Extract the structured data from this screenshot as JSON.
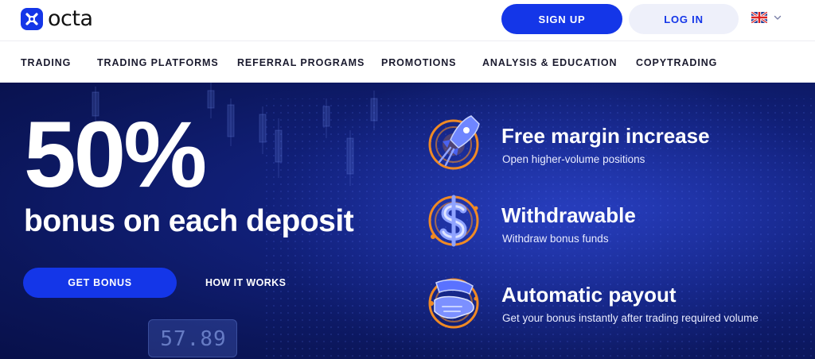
{
  "brand": {
    "name": "octa"
  },
  "header": {
    "signup_label": "SIGN UP",
    "login_label": "LOG IN",
    "language_icon": "uk-flag-icon",
    "language_chevron": "chevron-down-icon"
  },
  "nav": {
    "items": [
      {
        "label": "TRADING"
      },
      {
        "label": "TRADING PLATFORMS"
      },
      {
        "label": "REFERRAL PROGRAMS"
      },
      {
        "label": "PROMOTIONS"
      },
      {
        "label": "ANALYSIS & EDUCATION"
      },
      {
        "label": "COPYTRADING"
      }
    ]
  },
  "hero": {
    "headline": "50%",
    "subheadline": "bonus on each deposit",
    "cta_label": "GET BONUS",
    "secondary_link": "HOW IT WORKS",
    "ticker_value": "57.89",
    "features": [
      {
        "icon": "rocket-icon",
        "title": "Free margin increase",
        "description": "Open higher-volume positions"
      },
      {
        "icon": "dollar-icon",
        "title": "Withdrawable",
        "description": "Withdraw bonus funds"
      },
      {
        "icon": "money-hand-icon",
        "title": "Automatic payout",
        "description": "Get your bonus instantly after trading required volume"
      }
    ]
  },
  "colors": {
    "brand_blue": "#1436e8",
    "hero_background": "#0b165a",
    "login_bg": "#eef0fa",
    "icon_orange": "#f08a24"
  }
}
